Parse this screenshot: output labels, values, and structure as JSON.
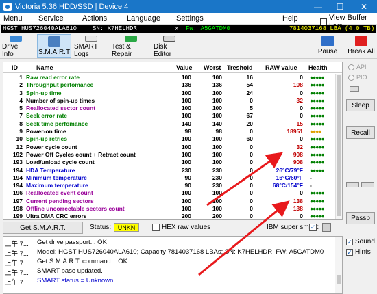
{
  "window": {
    "title": "Victoria 5.36 HDD/SSD | Device 4",
    "minimize": "—",
    "maximize": "☐",
    "close": "✕"
  },
  "menu": {
    "items": [
      "Menu",
      "Service",
      "Actions",
      "Language",
      "Settings",
      "Help"
    ],
    "view_buffer_live": "View Buffer Live"
  },
  "device": {
    "model": "HGST HUS726040ALA610",
    "serial": "SN: K7HELHDR",
    "x": "x",
    "firmware": "Fw: A5GATDM0",
    "lba": "7814037168 LBA (4.0 TB)"
  },
  "toolbar": {
    "drive_info": "Drive Info",
    "smart": "S.M.A.R.T",
    "smart_logs": "SMART Logs",
    "test_repair": "Test & Repair",
    "disk_editor": "Disk Editor",
    "pause": "Pause",
    "break_all": "Break All"
  },
  "table": {
    "headers": [
      "ID",
      "Name",
      "Value",
      "Worst",
      "Treshold",
      "RAW value",
      "Health"
    ],
    "rows": [
      {
        "id": "1",
        "name": "Raw read error rate",
        "value": "100",
        "worst": "100",
        "thr": "16",
        "raw": "0",
        "health": "●●●●●",
        "name_color": "#008000",
        "raw_color": "#000000",
        "health_color": "#008000"
      },
      {
        "id": "2",
        "name": "Throughput perfomance",
        "value": "136",
        "worst": "136",
        "thr": "54",
        "raw": "108",
        "health": "●●●●●",
        "name_color": "#008000",
        "raw_color": "#c00000",
        "health_color": "#008000"
      },
      {
        "id": "3",
        "name": "Spin-up time",
        "value": "100",
        "worst": "100",
        "thr": "24",
        "raw": "0",
        "health": "●●●●●",
        "name_color": "#008000",
        "raw_color": "#000000",
        "health_color": "#008000"
      },
      {
        "id": "4",
        "name": "Number of spin-up times",
        "value": "100",
        "worst": "100",
        "thr": "0",
        "raw": "32",
        "health": "●●●●●",
        "name_color": "#000000",
        "raw_color": "#c00000",
        "health_color": "#008000"
      },
      {
        "id": "5",
        "name": "Reallocated sector count",
        "value": "100",
        "worst": "100",
        "thr": "5",
        "raw": "0",
        "health": "●●●●●",
        "name_color": "#990099",
        "raw_color": "#000000",
        "health_color": "#008000"
      },
      {
        "id": "7",
        "name": "Seek error rate",
        "value": "100",
        "worst": "100",
        "thr": "67",
        "raw": "0",
        "health": "●●●●●",
        "name_color": "#008000",
        "raw_color": "#000000",
        "health_color": "#008000"
      },
      {
        "id": "8",
        "name": "Seek time perfomance",
        "value": "140",
        "worst": "140",
        "thr": "20",
        "raw": "15",
        "health": "●●●●●",
        "name_color": "#008000",
        "raw_color": "#c00000",
        "health_color": "#008000"
      },
      {
        "id": "9",
        "name": "Power-on time",
        "value": "98",
        "worst": "98",
        "thr": "0",
        "raw": "18951",
        "health": "●●●●",
        "name_color": "#000000",
        "raw_color": "#c00000",
        "health_color": "#e0a000"
      },
      {
        "id": "10",
        "name": "Spin-up retries",
        "value": "100",
        "worst": "100",
        "thr": "60",
        "raw": "0",
        "health": "●●●●●",
        "name_color": "#008000",
        "raw_color": "#000000",
        "health_color": "#008000"
      },
      {
        "id": "12",
        "name": "Power cycle count",
        "value": "100",
        "worst": "100",
        "thr": "0",
        "raw": "32",
        "health": "●●●●●",
        "name_color": "#000000",
        "raw_color": "#c00000",
        "health_color": "#008000"
      },
      {
        "id": "192",
        "name": "Power Off Cycles count + Retract count",
        "value": "100",
        "worst": "100",
        "thr": "0",
        "raw": "908",
        "health": "●●●●●",
        "name_color": "#000000",
        "raw_color": "#c00000",
        "health_color": "#008000"
      },
      {
        "id": "193",
        "name": "Load/unload cycle count",
        "value": "100",
        "worst": "100",
        "thr": "0",
        "raw": "908",
        "health": "●●●●●",
        "name_color": "#000000",
        "raw_color": "#c00000",
        "health_color": "#008000"
      },
      {
        "id": "194",
        "name": "HDA Temperature",
        "value": "230",
        "worst": "230",
        "thr": "0",
        "raw": "26°C/79°F",
        "health": "●●●●●",
        "name_color": "#0000cc",
        "raw_color": "#0000cc",
        "health_color": "#008000"
      },
      {
        "id": "194",
        "name": "Minimum temperature",
        "value": "90",
        "worst": "230",
        "thr": "0",
        "raw": "16°C/60°F",
        "health": "-",
        "name_color": "#0000cc",
        "raw_color": "#0000cc",
        "health_color": "#000000"
      },
      {
        "id": "194",
        "name": "Maximum temperature",
        "value": "90",
        "worst": "230",
        "thr": "0",
        "raw": "68°C/154°F",
        "health": "-",
        "name_color": "#0000cc",
        "raw_color": "#0000cc",
        "health_color": "#000000"
      },
      {
        "id": "196",
        "name": "Reallocated event count",
        "value": "100",
        "worst": "100",
        "thr": "0",
        "raw": "0",
        "health": "●●●●●",
        "name_color": "#990099",
        "raw_color": "#000000",
        "health_color": "#008000"
      },
      {
        "id": "197",
        "name": "Current pending sectors",
        "value": "100",
        "worst": "100",
        "thr": "0",
        "raw": "138",
        "health": "●●●●●",
        "name_color": "#990099",
        "raw_color": "#c00000",
        "health_color": "#008000"
      },
      {
        "id": "198",
        "name": "Offline uncorrectable sectors count",
        "value": "100",
        "worst": "100",
        "thr": "0",
        "raw": "138",
        "health": "●●●●●",
        "name_color": "#990099",
        "raw_color": "#c00000",
        "health_color": "#008000"
      },
      {
        "id": "199",
        "name": "Ultra DMA CRC errors",
        "value": "200",
        "worst": "200",
        "thr": "0",
        "raw": "0",
        "health": "●●●●●",
        "name_color": "#000000",
        "raw_color": "#000000",
        "health_color": "#008000"
      }
    ]
  },
  "status": {
    "get_smart": "Get S.M.A.R.T.",
    "label": "Status:",
    "value": "UNKN",
    "hex_raw": "HEX raw values",
    "ibm": "IBM super smart:",
    "ibm_checked": "✓"
  },
  "side": {
    "api": "API",
    "pio": "PIO",
    "sleep": "Sleep",
    "recall": "Recall",
    "passp": "Passp",
    "sound": "Sound",
    "hints": "Hints",
    "check": "✓"
  },
  "log": [
    {
      "time": "上午 7...",
      "msg": "Get drive passport... OK",
      "color": "#000000"
    },
    {
      "time": "上午 7...",
      "msg": "Model: HGST HUS726040ALA610; Capacity 7814037168 LBAs; SN: K7HELHDR; FW: A5GATDM0",
      "color": "#000000"
    },
    {
      "time": "上午 7...",
      "msg": "Get S.M.A.R.T. command... OK",
      "color": "#000000"
    },
    {
      "time": "上午 7...",
      "msg": "SMART base updated.",
      "color": "#000000"
    },
    {
      "time": "上午 7...",
      "msg": "SMART status = Unknown",
      "color": "#0000cc"
    }
  ],
  "colors": {
    "titlebar": "#1a76c8",
    "devbar_bg": "#000000",
    "model_bg": "#000000",
    "model_fg": "#ffffff",
    "serial_fg": "#ffffff",
    "fw_fg": "#00ff00",
    "lba_fg": "#ffff00",
    "annotation_arrow": "#e8191c"
  }
}
